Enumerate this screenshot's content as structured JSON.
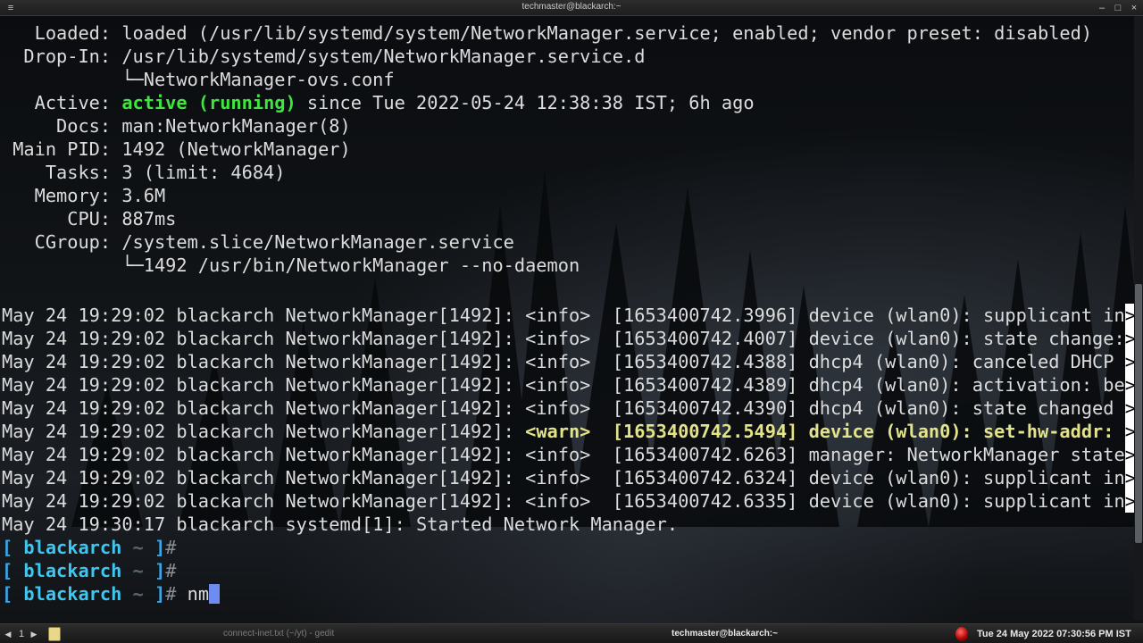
{
  "window": {
    "title": "techmaster@blackarch:~",
    "menu_glyph": "≡",
    "minimize_glyph": "–",
    "maximize_glyph": "□",
    "close_glyph": "×"
  },
  "status": {
    "loaded_label": "   Loaded:",
    "loaded_value": " loaded (/usr/lib/systemd/system/NetworkManager.service; enabled; vendor preset: disabled)",
    "dropin_label": "  Drop-In:",
    "dropin_value": " /usr/lib/systemd/system/NetworkManager.service.d",
    "dropin_sub": "           └─NetworkManager-ovs.conf",
    "active_label": "   Active:",
    "active_state": "active (running)",
    "active_rest": " since Tue 2022-05-24 12:38:38 IST; 6h ago",
    "docs": "     Docs: man:NetworkManager(8)",
    "mainpid": " Main PID: 1492 (NetworkManager)",
    "tasks": "    Tasks: 3 (limit: 4684)",
    "memory": "   Memory: 3.6M",
    "cpu": "      CPU: 887ms",
    "cgroup": "   CGroup: /system.slice/NetworkManager.service",
    "cgroup_sub": "           └─1492 /usr/bin/NetworkManager --no-daemon"
  },
  "log": [
    {
      "prefix": "May 24 19:29:02 blackarch NetworkManager[1492]: ",
      "level": "<info> ",
      "rest": " [1653400742.3996] device (wlan0): supplicant in",
      "warn": false
    },
    {
      "prefix": "May 24 19:29:02 blackarch NetworkManager[1492]: ",
      "level": "<info> ",
      "rest": " [1653400742.4007] device (wlan0): state change:",
      "warn": false
    },
    {
      "prefix": "May 24 19:29:02 blackarch NetworkManager[1492]: ",
      "level": "<info> ",
      "rest": " [1653400742.4388] dhcp4 (wlan0): canceled DHCP ",
      "warn": false
    },
    {
      "prefix": "May 24 19:29:02 blackarch NetworkManager[1492]: ",
      "level": "<info> ",
      "rest": " [1653400742.4389] dhcp4 (wlan0): activation: be",
      "warn": false
    },
    {
      "prefix": "May 24 19:29:02 blackarch NetworkManager[1492]: ",
      "level": "<info> ",
      "rest": " [1653400742.4390] dhcp4 (wlan0): state changed ",
      "warn": false
    },
    {
      "prefix": "May 24 19:29:02 blackarch NetworkManager[1492]: ",
      "level": "<warn> ",
      "rest": " [1653400742.5494] device (wlan0): set-hw-addr: ",
      "warn": true
    },
    {
      "prefix": "May 24 19:29:02 blackarch NetworkManager[1492]: ",
      "level": "<info> ",
      "rest": " [1653400742.6263] manager: NetworkManager state",
      "warn": false
    },
    {
      "prefix": "May 24 19:29:02 blackarch NetworkManager[1492]: ",
      "level": "<info> ",
      "rest": " [1653400742.6324] device (wlan0): supplicant in",
      "warn": false
    },
    {
      "prefix": "May 24 19:29:02 blackarch NetworkManager[1492]: ",
      "level": "<info> ",
      "rest": " [1653400742.6335] device (wlan0): supplicant in",
      "warn": false
    }
  ],
  "trunc_glyph": ">",
  "started_line": "May 24 19:30:17 blackarch systemd[1]: Started Network Manager.",
  "prompt": {
    "open": "[ ",
    "host": "blackarch",
    "tilde": " ~ ",
    "close": "]",
    "hash": "#",
    "command": " nm"
  },
  "taskbar": {
    "prev_glyph": "◀",
    "workspace": "1",
    "next_glyph": "▶",
    "gedit_task": "connect-inet.txt (~/yt) - gedit",
    "terminal_task": "techmaster@blackarch:~",
    "clock": "Tue 24 May 2022 07:30:56 PM IST"
  },
  "colors": {
    "active": "#3ee63e",
    "warn": "#e3e38a",
    "prompt_host": "#3ec7f0",
    "cursor": "#6d8cf0"
  }
}
